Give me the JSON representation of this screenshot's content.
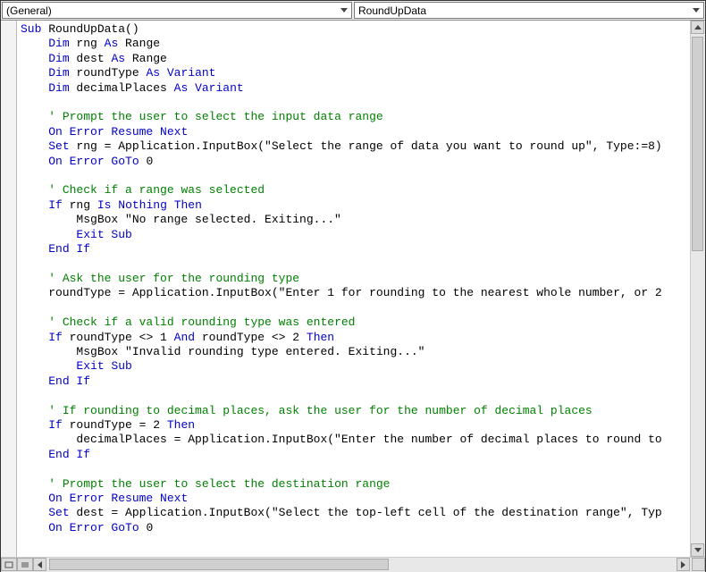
{
  "dropdowns": {
    "object": "(General)",
    "procedure": "RoundUpData"
  },
  "code_lines": [
    [
      [
        "k",
        "Sub"
      ],
      [
        "t",
        " RoundUpData()"
      ]
    ],
    [
      [
        "t",
        "    "
      ],
      [
        "k",
        "Dim"
      ],
      [
        "t",
        " rng "
      ],
      [
        "k",
        "As"
      ],
      [
        "t",
        " Range"
      ]
    ],
    [
      [
        "t",
        "    "
      ],
      [
        "k",
        "Dim"
      ],
      [
        "t",
        " dest "
      ],
      [
        "k",
        "As"
      ],
      [
        "t",
        " Range"
      ]
    ],
    [
      [
        "t",
        "    "
      ],
      [
        "k",
        "Dim"
      ],
      [
        "t",
        " roundType "
      ],
      [
        "k",
        "As"
      ],
      [
        "t",
        " "
      ],
      [
        "k",
        "Variant"
      ]
    ],
    [
      [
        "t",
        "    "
      ],
      [
        "k",
        "Dim"
      ],
      [
        "t",
        " decimalPlaces "
      ],
      [
        "k",
        "As"
      ],
      [
        "t",
        " "
      ],
      [
        "k",
        "Variant"
      ]
    ],
    [
      [
        "t",
        ""
      ]
    ],
    [
      [
        "t",
        "    "
      ],
      [
        "c",
        "' Prompt the user to select the input data range"
      ]
    ],
    [
      [
        "t",
        "    "
      ],
      [
        "k",
        "On Error Resume Next"
      ]
    ],
    [
      [
        "t",
        "    "
      ],
      [
        "k",
        "Set"
      ],
      [
        "t",
        " rng = Application.InputBox(\"Select the range of data you want to round up\", Type:=8)"
      ]
    ],
    [
      [
        "t",
        "    "
      ],
      [
        "k",
        "On Error GoTo"
      ],
      [
        "t",
        " 0"
      ]
    ],
    [
      [
        "t",
        ""
      ]
    ],
    [
      [
        "t",
        "    "
      ],
      [
        "c",
        "' Check if a range was selected"
      ]
    ],
    [
      [
        "t",
        "    "
      ],
      [
        "k",
        "If"
      ],
      [
        "t",
        " rng "
      ],
      [
        "k",
        "Is"
      ],
      [
        "t",
        " "
      ],
      [
        "k",
        "Nothing"
      ],
      [
        "t",
        " "
      ],
      [
        "k",
        "Then"
      ]
    ],
    [
      [
        "t",
        "        MsgBox \"No range selected. Exiting...\""
      ]
    ],
    [
      [
        "t",
        "        "
      ],
      [
        "k",
        "Exit Sub"
      ]
    ],
    [
      [
        "t",
        "    "
      ],
      [
        "k",
        "End If"
      ]
    ],
    [
      [
        "t",
        ""
      ]
    ],
    [
      [
        "t",
        "    "
      ],
      [
        "c",
        "' Ask the user for the rounding type"
      ]
    ],
    [
      [
        "t",
        "    roundType = Application.InputBox(\"Enter 1 for rounding to the nearest whole number, or 2"
      ]
    ],
    [
      [
        "t",
        ""
      ]
    ],
    [
      [
        "t",
        "    "
      ],
      [
        "c",
        "' Check if a valid rounding type was entered"
      ]
    ],
    [
      [
        "t",
        "    "
      ],
      [
        "k",
        "If"
      ],
      [
        "t",
        " roundType <> 1 "
      ],
      [
        "k",
        "And"
      ],
      [
        "t",
        " roundType <> 2 "
      ],
      [
        "k",
        "Then"
      ]
    ],
    [
      [
        "t",
        "        MsgBox \"Invalid rounding type entered. Exiting...\""
      ]
    ],
    [
      [
        "t",
        "        "
      ],
      [
        "k",
        "Exit Sub"
      ]
    ],
    [
      [
        "t",
        "    "
      ],
      [
        "k",
        "End If"
      ]
    ],
    [
      [
        "t",
        ""
      ]
    ],
    [
      [
        "t",
        "    "
      ],
      [
        "c",
        "' If rounding to decimal places, ask the user for the number of decimal places"
      ]
    ],
    [
      [
        "t",
        "    "
      ],
      [
        "k",
        "If"
      ],
      [
        "t",
        " roundType = 2 "
      ],
      [
        "k",
        "Then"
      ]
    ],
    [
      [
        "t",
        "        decimalPlaces = Application.InputBox(\"Enter the number of decimal places to round to"
      ]
    ],
    [
      [
        "t",
        "    "
      ],
      [
        "k",
        "End If"
      ]
    ],
    [
      [
        "t",
        ""
      ]
    ],
    [
      [
        "t",
        "    "
      ],
      [
        "c",
        "' Prompt the user to select the destination range"
      ]
    ],
    [
      [
        "t",
        "    "
      ],
      [
        "k",
        "On Error Resume Next"
      ]
    ],
    [
      [
        "t",
        "    "
      ],
      [
        "k",
        "Set"
      ],
      [
        "t",
        " dest = Application.InputBox(\"Select the top-left cell of the destination range\", Typ"
      ]
    ],
    [
      [
        "t",
        "    "
      ],
      [
        "k",
        "On Error GoTo"
      ],
      [
        "t",
        " 0"
      ]
    ],
    [
      [
        "t",
        ""
      ]
    ]
  ]
}
